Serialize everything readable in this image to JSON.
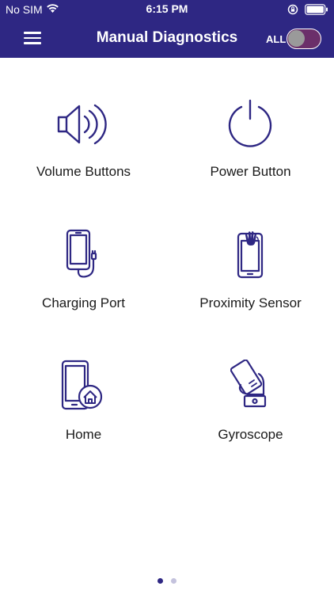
{
  "status_bar": {
    "carrier": "No SIM",
    "time": "6:15 PM",
    "icons": [
      "wifi-icon",
      "rotation-lock-icon",
      "battery-icon"
    ]
  },
  "header": {
    "title": "Manual Diagnostics",
    "menu_icon": "hamburger-menu-icon",
    "toggle_label": "ALL",
    "toggle_on": false
  },
  "tiles": [
    {
      "label": "Volume Buttons",
      "icon": "speaker-volume-icon"
    },
    {
      "label": "Power Button",
      "icon": "power-icon"
    },
    {
      "label": "Charging Port",
      "icon": "phone-charging-icon"
    },
    {
      "label": "Proximity Sensor",
      "icon": "proximity-hand-phone-icon"
    },
    {
      "label": "Home",
      "icon": "phone-home-icon"
    },
    {
      "label": "Gyroscope",
      "icon": "gyroscope-hand-phone-icon"
    }
  ],
  "pagination": {
    "pages": 2,
    "current": 1
  },
  "colors": {
    "header_bg": "#2e2783",
    "icon_stroke": "#2e2783",
    "toggle_track": "#6b2f6a"
  }
}
